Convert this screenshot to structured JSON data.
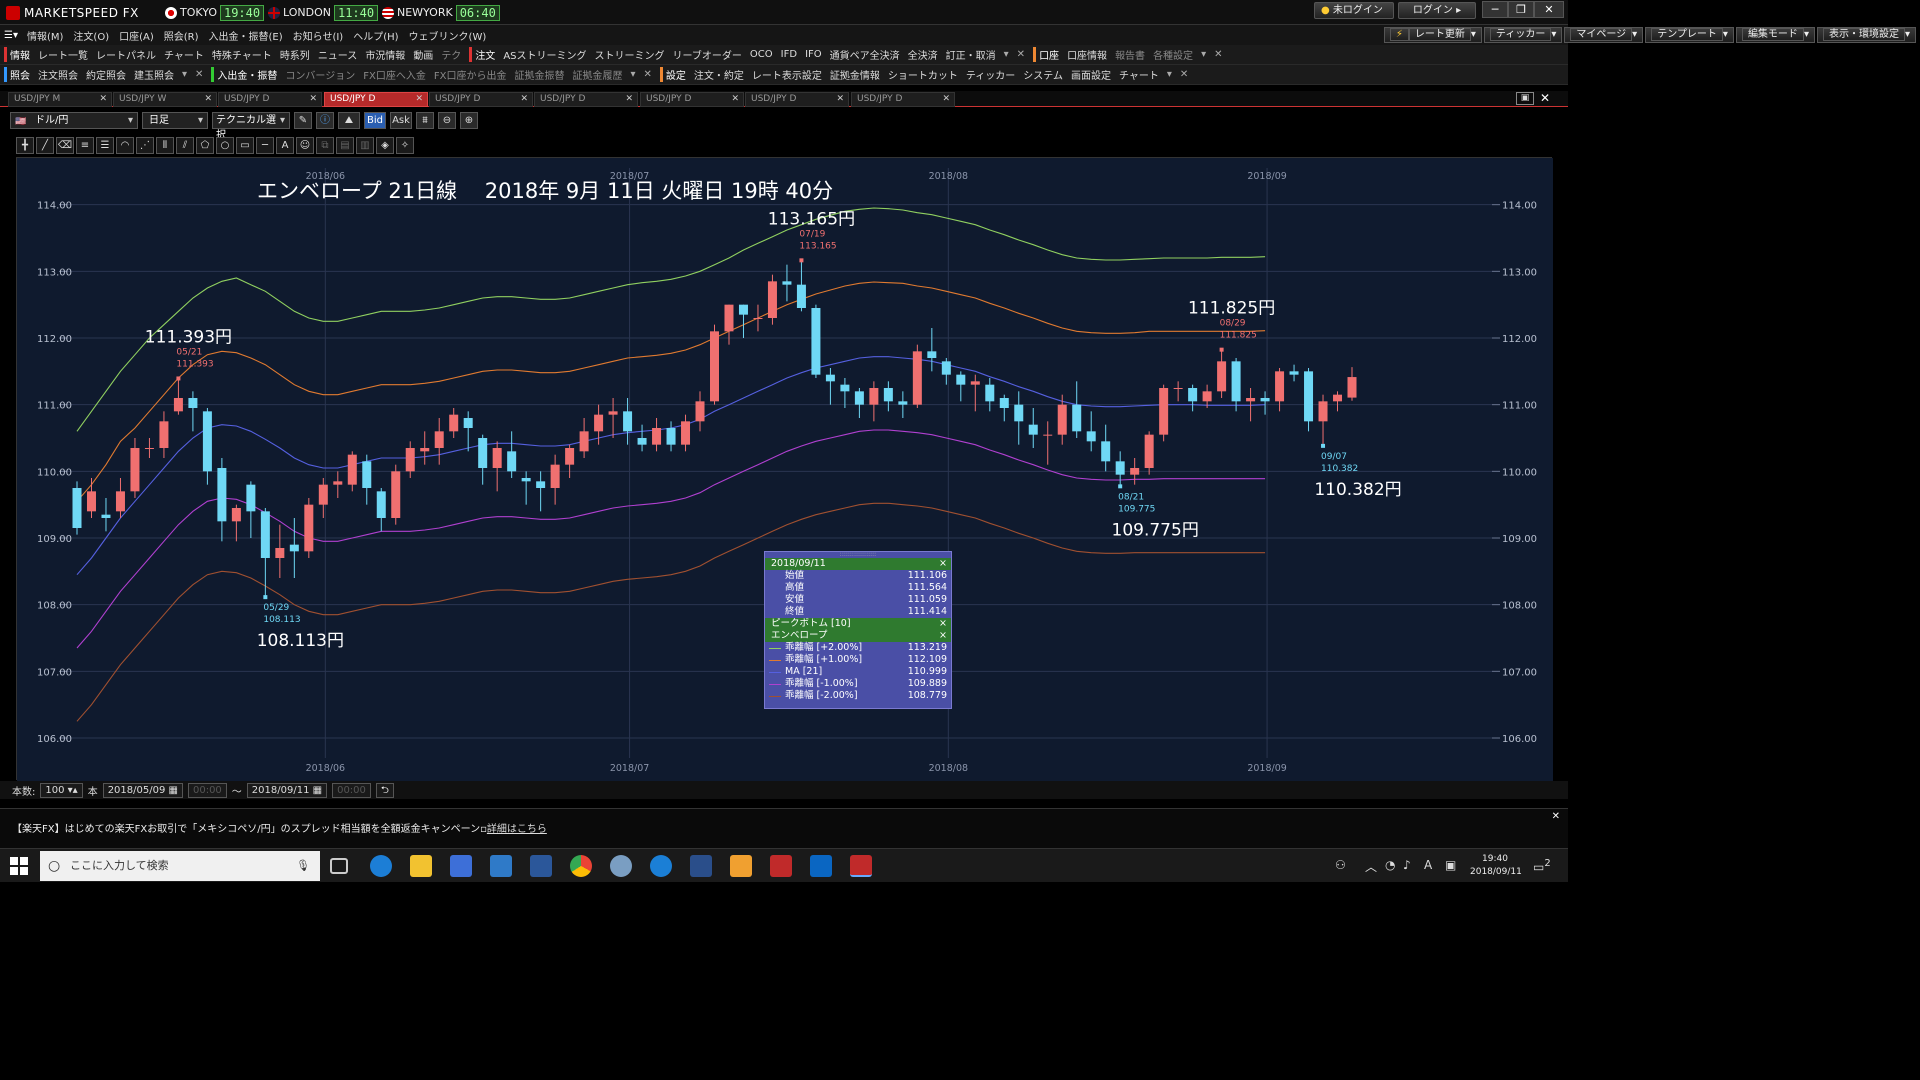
{
  "app": {
    "title": "MARKETSPEED FX",
    "clocks": [
      {
        "city": "TOKYO",
        "time": "19:40"
      },
      {
        "city": "LONDON",
        "time": "11:40"
      },
      {
        "city": "NEWYORK",
        "time": "06:40"
      }
    ],
    "status": "未ログイン",
    "login": "ログイン"
  },
  "menu": [
    "情報(M)",
    "注文(O)",
    "口座(A)",
    "照会(R)",
    "入出金・振替(E)",
    "お知らせ(I)",
    "ヘルプ(H)",
    "ウェブリンク(W)"
  ],
  "right_buttons": [
    "レート更新",
    "ティッカー",
    "マイページ",
    "テンプレート",
    "編集モード",
    "表示・環境設定"
  ],
  "toolbar1": {
    "info_group": "情報",
    "info_items": [
      "レート一覧",
      "レートパネル",
      "チャート",
      "特殊チャート",
      "時系列",
      "ニュース",
      "市況情報",
      "動画",
      "テク"
    ],
    "order_group": "注文",
    "order_items": [
      "ASストリーミング",
      "ストリーミング",
      "リーブオーダー",
      "OCO",
      "IFD",
      "IFO",
      "通貨ペア全決済",
      "全決済",
      "訂正・取消"
    ],
    "account_group": "口座",
    "account_items": [
      "口座情報",
      "報告書",
      "各種設定"
    ]
  },
  "toolbar2": {
    "inquiry_group": "照会",
    "inquiry_items": [
      "注文照会",
      "約定照会",
      "建玉照会"
    ],
    "transfer_group": "入出金・振替",
    "transfer_items": [
      "コンバージョン",
      "FX口座へ入金",
      "FX口座から出金",
      "証拠金振替",
      "証拠金履歴"
    ],
    "settings_group": "設定",
    "settings_items": [
      "注文・約定",
      "レート表示設定",
      "証拠金情報",
      "ショートカット",
      "ティッカー",
      "システム",
      "画面設定",
      "チャート"
    ]
  },
  "tabs": [
    "USD/JPY M",
    "USD/JPY W",
    "USD/JPY D",
    "USD/JPY D",
    "USD/JPY D",
    "USD/JPY D",
    "USD/JPY D",
    "USD/JPY D",
    "USD/JPY D"
  ],
  "active_tab_index": 3,
  "controls": {
    "pair": "ドル/円",
    "period": "日足",
    "technical": "テクニカル選択",
    "bid": "Bid",
    "ask": "Ask"
  },
  "chart_data": {
    "type": "candlestick",
    "title": "エンベロープ 21日線　 2018年 9月 11日 火曜日 19時 40分",
    "x_labels": [
      "2018/06",
      "2018/07",
      "2018/08",
      "2018/09"
    ],
    "ylim": [
      105.7,
      114.4
    ],
    "y_ticks": [
      "106.00",
      "107.00",
      "108.00",
      "109.00",
      "110.00",
      "111.00",
      "112.00",
      "113.00",
      "114.00"
    ],
    "annotations": [
      {
        "big": "111.393円",
        "date": "05/21",
        "value": "111.393",
        "kind": "high"
      },
      {
        "big": "108.113円",
        "date": "05/29",
        "value": "108.113",
        "kind": "low"
      },
      {
        "big": "113.165円",
        "date": "07/19",
        "value": "113.165",
        "kind": "high"
      },
      {
        "big": "109.775円",
        "date": "08/21",
        "value": "109.775",
        "kind": "low"
      },
      {
        "big": "111.825円",
        "date": "08/29",
        "value": "111.825",
        "kind": "high"
      },
      {
        "big": "110.382円",
        "date": "09/07",
        "value": "110.382",
        "kind": "low"
      }
    ],
    "candles": [
      [
        109.75,
        109.15,
        109.85,
        109.05
      ],
      [
        109.4,
        109.7,
        109.9,
        109.3
      ],
      [
        109.35,
        109.3,
        109.6,
        109.1
      ],
      [
        109.4,
        109.7,
        109.9,
        109.3
      ],
      [
        109.7,
        110.35,
        110.5,
        109.6
      ],
      [
        110.35,
        110.35,
        110.5,
        110.2
      ],
      [
        110.35,
        110.75,
        110.9,
        110.2
      ],
      [
        110.9,
        111.1,
        111.393,
        110.85
      ],
      [
        111.1,
        110.95,
        111.2,
        110.6
      ],
      [
        110.9,
        110.0,
        110.95,
        109.8
      ],
      [
        110.05,
        109.25,
        110.2,
        108.95
      ],
      [
        109.25,
        109.45,
        109.5,
        108.95
      ],
      [
        109.8,
        109.4,
        109.85,
        109.0
      ],
      [
        109.4,
        108.7,
        109.45,
        108.113
      ],
      [
        108.7,
        108.85,
        109.2,
        108.4
      ],
      [
        108.9,
        108.8,
        109.3,
        108.4
      ],
      [
        108.8,
        109.5,
        109.6,
        108.7
      ],
      [
        109.5,
        109.8,
        109.9,
        109.3
      ],
      [
        109.8,
        109.85,
        110.0,
        109.6
      ],
      [
        109.8,
        110.25,
        110.3,
        109.7
      ],
      [
        110.15,
        109.75,
        110.25,
        109.5
      ],
      [
        109.7,
        109.3,
        109.75,
        109.1
      ],
      [
        109.3,
        110.0,
        110.1,
        109.2
      ],
      [
        110.0,
        110.35,
        110.45,
        109.9
      ],
      [
        110.3,
        110.35,
        110.6,
        110.1
      ],
      [
        110.35,
        110.6,
        110.8,
        110.1
      ],
      [
        110.6,
        110.85,
        110.95,
        110.5
      ],
      [
        110.8,
        110.65,
        110.9,
        110.3
      ],
      [
        110.5,
        110.05,
        110.55,
        109.8
      ],
      [
        110.05,
        110.35,
        110.45,
        109.7
      ],
      [
        110.3,
        110.0,
        110.6,
        109.9
      ],
      [
        109.9,
        109.85,
        110.0,
        109.5
      ],
      [
        109.85,
        109.75,
        110.0,
        109.4
      ],
      [
        109.75,
        110.1,
        110.25,
        109.5
      ],
      [
        110.1,
        110.35,
        110.4,
        109.9
      ],
      [
        110.3,
        110.6,
        110.8,
        110.2
      ],
      [
        110.6,
        110.85,
        111.0,
        110.4
      ],
      [
        110.85,
        110.9,
        111.1,
        110.5
      ],
      [
        110.9,
        110.6,
        111.1,
        110.4
      ],
      [
        110.5,
        110.4,
        110.7,
        110.3
      ],
      [
        110.4,
        110.65,
        110.8,
        110.3
      ],
      [
        110.65,
        110.4,
        110.75,
        110.3
      ],
      [
        110.4,
        110.75,
        110.85,
        110.3
      ],
      [
        110.75,
        111.05,
        111.2,
        110.6
      ],
      [
        111.05,
        112.1,
        112.2,
        111.0
      ],
      [
        112.1,
        112.5,
        112.5,
        111.9
      ],
      [
        112.5,
        112.35,
        112.5,
        112.0
      ],
      [
        112.3,
        112.3,
        112.5,
        112.1
      ],
      [
        112.3,
        112.85,
        112.95,
        112.2
      ],
      [
        112.85,
        112.8,
        113.1,
        112.55
      ],
      [
        112.8,
        112.45,
        113.165,
        112.4
      ],
      [
        112.45,
        111.45,
        112.5,
        111.4
      ],
      [
        111.45,
        111.35,
        111.55,
        111.0
      ],
      [
        111.3,
        111.2,
        111.4,
        110.95
      ],
      [
        111.2,
        111.0,
        111.25,
        110.8
      ],
      [
        111.0,
        111.25,
        111.35,
        110.75
      ],
      [
        111.25,
        111.05,
        111.35,
        110.9
      ],
      [
        111.05,
        111.0,
        111.2,
        110.8
      ],
      [
        111.0,
        111.8,
        111.9,
        110.95
      ],
      [
        111.8,
        111.7,
        112.15,
        111.5
      ],
      [
        111.65,
        111.45,
        111.7,
        111.3
      ],
      [
        111.45,
        111.3,
        111.5,
        111.05
      ],
      [
        111.3,
        111.35,
        111.45,
        110.9
      ],
      [
        111.3,
        111.05,
        111.4,
        110.9
      ],
      [
        111.1,
        110.95,
        111.15,
        110.75
      ],
      [
        111.0,
        110.75,
        111.2,
        110.4
      ],
      [
        110.7,
        110.55,
        110.95,
        110.35
      ],
      [
        110.55,
        110.55,
        110.75,
        110.1
      ],
      [
        110.55,
        111.0,
        111.15,
        110.4
      ],
      [
        111.0,
        110.6,
        111.35,
        110.5
      ],
      [
        110.6,
        110.45,
        110.9,
        110.3
      ],
      [
        110.45,
        110.15,
        110.7,
        110.0
      ],
      [
        110.15,
        109.95,
        110.3,
        109.775
      ],
      [
        109.95,
        110.05,
        110.2,
        109.8
      ],
      [
        110.05,
        110.55,
        110.6,
        109.95
      ],
      [
        110.55,
        111.25,
        111.3,
        110.45
      ],
      [
        111.25,
        111.25,
        111.35,
        111.05
      ],
      [
        111.25,
        111.05,
        111.3,
        110.9
      ],
      [
        111.05,
        111.2,
        111.3,
        110.95
      ],
      [
        111.2,
        111.65,
        111.825,
        111.1
      ],
      [
        111.65,
        111.05,
        111.7,
        110.9
      ],
      [
        111.05,
        111.1,
        111.25,
        110.75
      ],
      [
        111.1,
        111.05,
        111.2,
        110.85
      ],
      [
        111.05,
        111.5,
        111.55,
        110.9
      ],
      [
        111.5,
        111.45,
        111.6,
        111.35
      ],
      [
        111.5,
        110.75,
        111.55,
        110.6
      ],
      [
        110.75,
        111.05,
        111.15,
        110.382
      ],
      [
        111.05,
        111.15,
        111.2,
        110.9
      ],
      [
        111.106,
        111.414,
        111.564,
        111.059
      ]
    ],
    "envelope": {
      "ma": [
        108.45,
        108.7,
        109.0,
        109.3,
        109.55,
        109.8,
        110.05,
        110.3,
        110.5,
        110.65,
        110.7,
        110.68,
        110.6,
        110.48,
        110.35,
        110.2,
        110.1,
        110.05,
        110.05,
        110.1,
        110.15,
        110.2,
        110.2,
        110.2,
        110.22,
        110.25,
        110.3,
        110.35,
        110.4,
        110.42,
        110.42,
        110.4,
        110.38,
        110.38,
        110.4,
        110.45,
        110.5,
        110.55,
        110.58,
        110.6,
        110.62,
        110.65,
        110.7,
        110.78,
        110.9,
        111.0,
        111.1,
        111.2,
        111.3,
        111.4,
        111.48,
        111.55,
        111.6,
        111.65,
        111.7,
        111.72,
        111.72,
        111.7,
        111.68,
        111.65,
        111.6,
        111.55,
        111.5,
        111.42,
        111.35,
        111.27,
        111.2,
        111.12,
        111.05,
        111.0,
        110.98,
        110.97,
        110.97,
        110.98,
        110.99,
        111.0,
        111.0,
        111.0,
        110.99,
        110.99,
        110.99,
        110.99,
        110.999
      ],
      "up1": [
        109.55,
        109.8,
        110.1,
        110.45,
        110.65,
        110.9,
        111.15,
        111.4,
        111.6,
        111.75,
        111.8,
        111.78,
        111.7,
        111.6,
        111.45,
        111.3,
        111.2,
        111.15,
        111.15,
        111.2,
        111.25,
        111.3,
        111.3,
        111.3,
        111.32,
        111.35,
        111.4,
        111.45,
        111.5,
        111.52,
        111.52,
        111.5,
        111.48,
        111.48,
        111.5,
        111.55,
        111.6,
        111.65,
        111.7,
        111.72,
        111.74,
        111.77,
        111.82,
        111.9,
        112.0,
        112.1,
        112.2,
        112.3,
        112.4,
        112.5,
        112.58,
        112.66,
        112.72,
        112.78,
        112.82,
        112.84,
        112.83,
        112.82,
        112.78,
        112.75,
        112.7,
        112.65,
        112.6,
        112.52,
        112.45,
        112.37,
        112.3,
        112.22,
        112.15,
        112.1,
        112.08,
        112.07,
        112.07,
        112.08,
        112.1,
        112.1,
        112.1,
        112.1,
        112.1,
        112.1,
        112.1,
        112.1,
        112.109
      ],
      "up2": [
        110.6,
        110.9,
        111.2,
        111.5,
        111.75,
        112.0,
        112.2,
        112.4,
        112.6,
        112.75,
        112.85,
        112.9,
        112.8,
        112.7,
        112.55,
        112.4,
        112.3,
        112.25,
        112.25,
        112.3,
        112.35,
        112.4,
        112.4,
        112.4,
        112.42,
        112.45,
        112.5,
        112.55,
        112.6,
        112.62,
        112.62,
        112.6,
        112.58,
        112.58,
        112.6,
        112.65,
        112.7,
        112.75,
        112.8,
        112.83,
        112.85,
        112.88,
        112.93,
        113.0,
        113.1,
        113.2,
        113.32,
        113.42,
        113.52,
        113.62,
        113.7,
        113.78,
        113.84,
        113.9,
        113.93,
        113.95,
        113.94,
        113.92,
        113.88,
        113.85,
        113.8,
        113.75,
        113.7,
        113.62,
        113.55,
        113.47,
        113.4,
        113.32,
        113.25,
        113.2,
        113.18,
        113.17,
        113.17,
        113.18,
        113.19,
        113.2,
        113.2,
        113.2,
        113.2,
        113.21,
        113.21,
        113.21,
        113.219
      ],
      "dn1": [
        107.35,
        107.6,
        107.9,
        108.2,
        108.45,
        108.7,
        108.95,
        109.2,
        109.4,
        109.55,
        109.6,
        109.58,
        109.5,
        109.38,
        109.25,
        109.1,
        109.0,
        108.95,
        108.95,
        109.0,
        109.05,
        109.1,
        109.1,
        109.1,
        109.12,
        109.15,
        109.2,
        109.25,
        109.3,
        109.32,
        109.32,
        109.3,
        109.28,
        109.28,
        109.3,
        109.35,
        109.4,
        109.45,
        109.48,
        109.5,
        109.52,
        109.55,
        109.6,
        109.68,
        109.8,
        109.9,
        110.0,
        110.1,
        110.2,
        110.3,
        110.38,
        110.45,
        110.5,
        110.55,
        110.6,
        110.62,
        110.62,
        110.6,
        110.58,
        110.55,
        110.5,
        110.45,
        110.4,
        110.32,
        110.25,
        110.17,
        110.1,
        110.02,
        109.95,
        109.9,
        109.88,
        109.87,
        109.87,
        109.88,
        109.88,
        109.89,
        109.89,
        109.89,
        109.89,
        109.89,
        109.89,
        109.89,
        109.889
      ],
      "dn2": [
        106.25,
        106.5,
        106.8,
        107.1,
        107.35,
        107.6,
        107.85,
        108.1,
        108.3,
        108.45,
        108.5,
        108.48,
        108.4,
        108.28,
        108.15,
        108.0,
        107.9,
        107.85,
        107.85,
        107.9,
        107.95,
        108.0,
        108.0,
        108.0,
        108.02,
        108.05,
        108.1,
        108.15,
        108.2,
        108.22,
        108.22,
        108.2,
        108.18,
        108.18,
        108.2,
        108.25,
        108.3,
        108.35,
        108.38,
        108.4,
        108.42,
        108.45,
        108.5,
        108.58,
        108.7,
        108.8,
        108.9,
        109.0,
        109.1,
        109.2,
        109.28,
        109.35,
        109.4,
        109.45,
        109.5,
        109.52,
        109.52,
        109.5,
        109.48,
        109.45,
        109.4,
        109.35,
        109.3,
        109.22,
        109.15,
        109.07,
        109.0,
        108.92,
        108.85,
        108.8,
        108.78,
        108.77,
        108.77,
        108.78,
        108.78,
        108.78,
        108.78,
        108.78,
        108.78,
        108.78,
        108.78,
        108.78,
        108.779
      ]
    },
    "colors": {
      "up": "#f07070",
      "down": "#6fd8f5",
      "ma": "#5560e0",
      "up1": "#e07a30",
      "up2": "#90d060",
      "dn1": "#b040d0",
      "dn2": "#a05030",
      "bg": "#0f1a2e",
      "grid": "#2a3550"
    }
  },
  "infobox": {
    "date": "2018/09/11",
    "ohlc": [
      {
        "k": "始値",
        "v": "111.106"
      },
      {
        "k": "高値",
        "v": "111.564"
      },
      {
        "k": "安値",
        "v": "111.059"
      },
      {
        "k": "終値",
        "v": "111.414"
      }
    ],
    "peak": "ピークボトム [10]",
    "env": "エンベロープ",
    "env_rows": [
      {
        "k": "乖離幅 [+2.00%]",
        "v": "113.219",
        "c": "#90d060"
      },
      {
        "k": "乖離幅 [+1.00%]",
        "v": "112.109",
        "c": "#e07a30"
      },
      {
        "k": "MA [21]",
        "v": "110.999",
        "c": "#5560e0"
      },
      {
        "k": "乖離幅 [-1.00%]",
        "v": "109.889",
        "c": "#b040d0"
      },
      {
        "k": "乖離幅 [-2.00%]",
        "v": "108.779",
        "c": "#a05030"
      }
    ]
  },
  "bottom": {
    "count_label": "本数:",
    "count": "100",
    "unit": "本",
    "from": "2018/05/09",
    "time_from": "00:00",
    "tilde": "～",
    "to": "2018/09/11",
    "time_to": "00:00"
  },
  "news": {
    "text": "【楽天FX】はじめての楽天FXお取引で「メキシコペソ/円」のスプレッド相当額を全額返金キャンペーン",
    "link": "詳細はこちら"
  },
  "taskbar": {
    "search_placeholder": "ここに入力して検索",
    "time": "19:40",
    "date": "2018/09/11",
    "ime": "A",
    "notif": "2"
  }
}
